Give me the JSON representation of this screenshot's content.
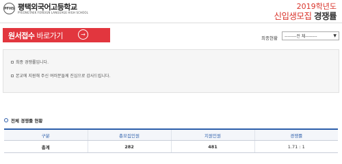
{
  "header": {
    "logo_emblem": "PFHS",
    "school_name": "평택외국어고등학교",
    "school_name_en": "PYEONGTAEK FOREIGN LANGUAGE HIGH SCHOOL",
    "year_label": "2019학년도",
    "title_lead": "신입생모집",
    "title_tail": "경쟁률"
  },
  "apply": {
    "label_bold": "원서접수",
    "label_light": "바로가기",
    "arrow": "→"
  },
  "filter": {
    "label": "최종현황",
    "selected": "--------전 체--------"
  },
  "notice": {
    "line1": "최종 경쟁률입니다.",
    "line2": "본교에 지원해 주신 여러분들께 진심으로 감사드립니다."
  },
  "section": {
    "title": "전체 경쟁률 현황"
  },
  "table": {
    "headers": [
      "구분",
      "총모집인원",
      "지원인원",
      "경쟁률"
    ],
    "rows": [
      [
        "총계",
        "282",
        "481",
        "1.71 : 1"
      ]
    ]
  }
}
